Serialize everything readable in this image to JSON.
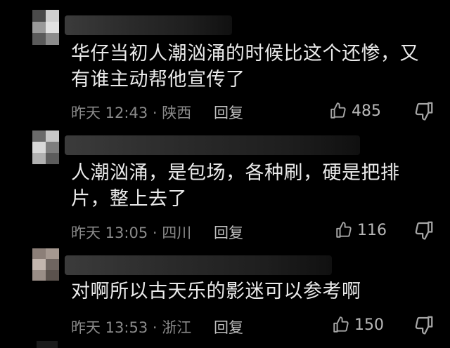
{
  "comments": [
    {
      "text": "华仔当初人潮汹涌的时候比这个还惨，又有谁主动帮他宣传了",
      "time": "昨天 12:43 · 陕西",
      "reply_label": "回复",
      "likes": "485",
      "like_icon": "thumbs-up-icon",
      "dislike_icon": "thumbs-down-icon"
    },
    {
      "text": "人潮汹涌，是包场，各种刷，硬是把排片，整上去了",
      "time": "昨天 13:05 · 四川",
      "reply_label": "回复",
      "likes": "116",
      "like_icon": "thumbs-up-icon",
      "dislike_icon": "thumbs-down-icon"
    },
    {
      "text": "对啊所以古天乐的影迷可以参考啊",
      "time": "昨天 13:53 · 浙江",
      "reply_label": "回复",
      "likes": "150",
      "like_icon": "thumbs-up-icon",
      "dislike_icon": "thumbs-down-icon"
    }
  ],
  "colors": {
    "background": "#000000",
    "text": "#eaeaea",
    "meta": "#8a8a8a",
    "icon": "#a6a6a6"
  }
}
